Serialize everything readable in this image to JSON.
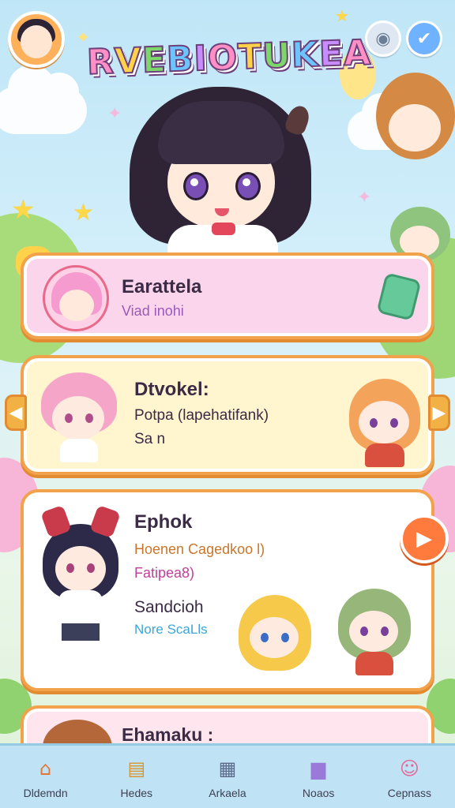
{
  "header": {
    "title": "RVEBIOTUKEA",
    "avatar_icon": "player-avatar",
    "right_icons": [
      "robot-icon",
      "check-icon"
    ]
  },
  "cards": [
    {
      "title": "Earattela",
      "lines": [
        "Viad inohi"
      ],
      "icon": "green-gift-icon"
    },
    {
      "title": "Dtvokel:",
      "lines": [
        "Potpa (lapehatifank)",
        "Sa n"
      ]
    },
    {
      "title": "Ephok",
      "lines": [
        "Hoenen Cagedkoo l)",
        "Fatipea8)",
        "Sandcioh",
        "Nore ScaLls"
      ]
    },
    {
      "title": "Ehamaku :",
      "lines": []
    }
  ],
  "controls": {
    "left_arrow": "◀",
    "right_arrow": "▶",
    "play": "▶"
  },
  "bottom_nav": [
    {
      "label": "Dldemdn",
      "icon": "home-icon",
      "glyph": "⌂"
    },
    {
      "label": "Hedes",
      "icon": "notebook-icon",
      "glyph": "▤"
    },
    {
      "label": "Arkaela",
      "icon": "calendar-icon",
      "glyph": "▦"
    },
    {
      "label": "Noaos",
      "icon": "paint-bucket-icon",
      "glyph": "▆"
    },
    {
      "label": "Cepnass",
      "icon": "character-icon",
      "glyph": "☺"
    }
  ],
  "colors": {
    "card_border": "#f2a24a",
    "card1_bg": "#fbd5ec",
    "card2_bg": "#fff6cf",
    "card3_bg": "#ffffff",
    "play_button": "#ff7a3d",
    "nav_bg": "#bfe3f4"
  }
}
